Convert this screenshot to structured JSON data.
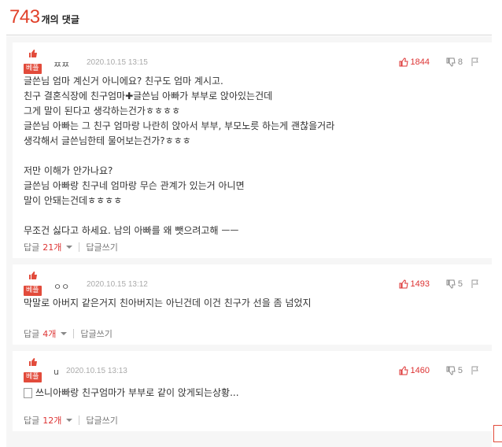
{
  "header": {
    "count": "743",
    "label": "개의 댓글"
  },
  "best_label": "베플",
  "reply_label": "답글",
  "write_reply_label": "답글쓰기",
  "comments": [
    {
      "user": "ㅉㅉ",
      "date": "2020.10.15 13:15",
      "likes": "1844",
      "dislikes": "8",
      "text": "글쓴님 엄마 계신거 아니에요? 친구도 엄마 계시고.\n친구 결혼식장에 친구엄마✚글쓴님 아빠가 부부로 앉아있는건데\n그게 말이 된다고 생각하는건가ㅎㅎㅎㅎ\n글쓴님 아빠는 그 친구 엄마랑 나란히 앉아서 부부, 부모노릇 하는게 괜찮을거라\n생각해서 글쓴님한테 물어보는건가?ㅎㅎㅎ\n\n저만 이해가 안가나요?\n글쓴님 아빠랑 친구네 엄마랑 무슨 관계가 있는거 아니면\n말이 안돼는건데ㅎㅎㅎㅎ\n\n무조건 싫다고 하세요. 남의 아빠를 왜 뺏으려고해 ㅡㅡ",
      "reply_count": "21개"
    },
    {
      "user": "ㅇㅇ",
      "date": "2020.10.15 13:12",
      "likes": "1493",
      "dislikes": "5",
      "text": "막말로 아버지 같은거지 친아버지는 아닌건데 이건 친구가 선을 좀 넘었지",
      "reply_count": "4개"
    },
    {
      "user": "u",
      "date": "2020.10.15 13:13",
      "likes": "1460",
      "dislikes": "5",
      "text": "쓰니아빠랑 친구엄마가 부부로 같이 앉게되는상황...",
      "reply_count": "12개"
    }
  ]
}
